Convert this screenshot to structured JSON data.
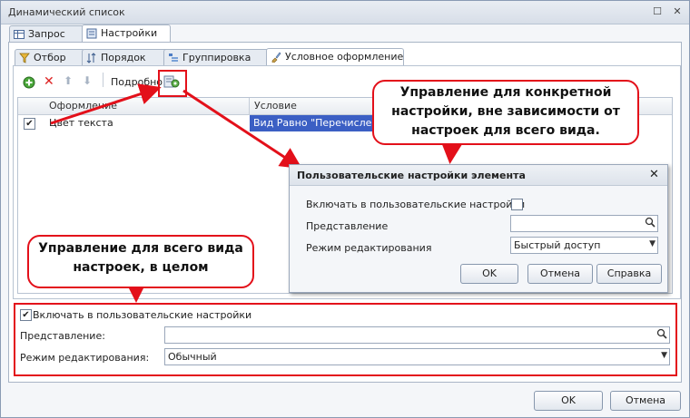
{
  "window": {
    "title": "Динамический список"
  },
  "tabs_top": [
    {
      "label": "Запрос"
    },
    {
      "label": "Настройки"
    }
  ],
  "tabs_inner": [
    {
      "label": "Отбор"
    },
    {
      "label": "Порядок"
    },
    {
      "label": "Группировка"
    },
    {
      "label": "Условное оформление"
    }
  ],
  "toolbar": {
    "detail_label": "Подробно"
  },
  "grid": {
    "columns": [
      "Оформление",
      "Условие"
    ],
    "rows": [
      {
        "checked": true,
        "appearance": "Цвет текста",
        "condition": "Вид Равно \"Перечисление"
      }
    ]
  },
  "callouts": {
    "specific": "Управление для конкретной настройки, вне зависимости от настроек для всего вида.",
    "whole": "Управление для всего вида настроек, в целом"
  },
  "element_dialog": {
    "title": "Пользовательские настройки элемента",
    "include_label": "Включать в пользовательские настройки",
    "presentation_label": "Представление",
    "presentation_value": "",
    "edit_mode_label": "Режим редактирования",
    "edit_mode_value": "Быстрый доступ",
    "ok": "OK",
    "cancel": "Отмена",
    "help": "Справка"
  },
  "bottom_settings": {
    "include_label": "Включать в пользовательские настройки",
    "include_checked": true,
    "presentation_label": "Представление:",
    "presentation_value": "",
    "edit_mode_label": "Режим редактирования:",
    "edit_mode_value": "Обычный"
  },
  "footer": {
    "ok": "OK",
    "cancel": "Отмена"
  },
  "colors": {
    "highlight": "#e3101a",
    "selection": "#3b5fc4"
  }
}
